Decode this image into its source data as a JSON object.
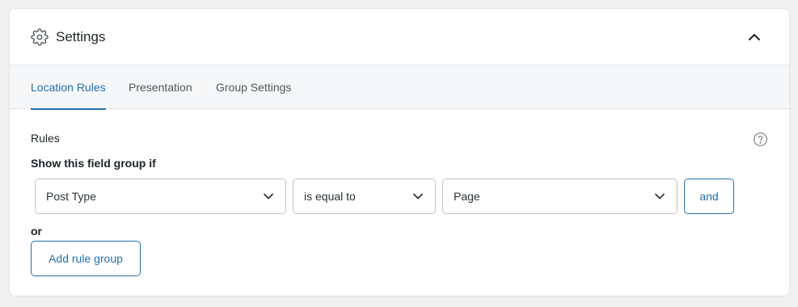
{
  "header": {
    "title": "Settings",
    "icon": "gear-icon",
    "collapse_icon": "chevron-up-icon"
  },
  "tabs": [
    {
      "label": "Location Rules",
      "active": true
    },
    {
      "label": "Presentation",
      "active": false
    },
    {
      "label": "Group Settings",
      "active": false
    }
  ],
  "rules": {
    "label": "Rules",
    "help_icon": "question-circle-icon",
    "show_label": "Show this field group if",
    "row": {
      "param": "Post Type",
      "operator": "is equal to",
      "value": "Page",
      "and_label": "and"
    },
    "or_label": "or",
    "add_group_label": "Add rule group"
  },
  "colors": {
    "accent": "#2271b1",
    "border": "#c3c4c7",
    "tab_bar_bg": "#f6f7f8",
    "page_bg": "#f0f0f1"
  }
}
